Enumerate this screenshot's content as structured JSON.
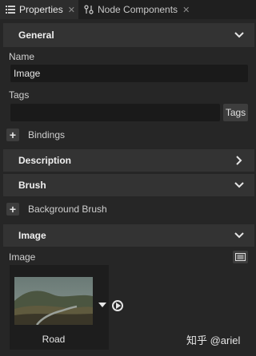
{
  "tabs": [
    {
      "label": "Properties",
      "icon": "list-icon",
      "active": true
    },
    {
      "label": "Node Components",
      "icon": "node-components-icon",
      "active": false
    }
  ],
  "general": {
    "title": "General",
    "name_label": "Name",
    "name_value": "Image",
    "tags_label": "Tags",
    "tags_value": "",
    "tags_button": "Tags",
    "bindings_label": "Bindings"
  },
  "description": {
    "title": "Description"
  },
  "brush": {
    "title": "Brush",
    "background_brush_label": "Background Brush"
  },
  "image_section": {
    "title": "Image",
    "image_label": "Image",
    "asset_name": "Road"
  },
  "watermark": "知乎 @ariel",
  "colors": {
    "bg": "#262626",
    "section": "#333333",
    "input": "#1a1a1a",
    "tabbar": "#1f1f1f"
  }
}
